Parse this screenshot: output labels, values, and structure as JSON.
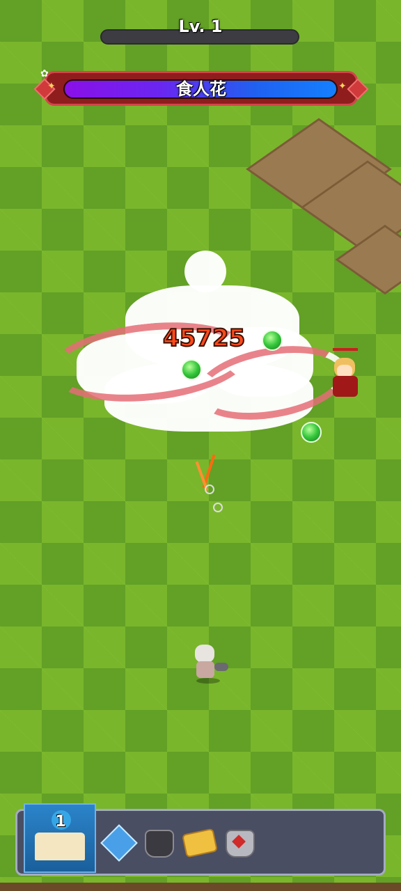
{
  "hud": {
    "level_label": "Lv. 1"
  },
  "boss": {
    "name": "食人花",
    "hp_fraction": 1.0
  },
  "combat": {
    "damage_numbers": [
      "4",
      "5",
      "7",
      "2",
      "5"
    ],
    "damage_display": "45725"
  },
  "skill_bar": {
    "book_level": "1",
    "slots": [
      {
        "icon": "ice-crystal-icon"
      },
      {
        "icon": "dark-armor-icon"
      },
      {
        "icon": "scroll-icon"
      },
      {
        "icon": "heart-armor-icon"
      }
    ]
  },
  "colors": {
    "grass_dark": "#62a026",
    "grass_light": "#8cc832",
    "boss_frame": "#8f1d1d",
    "hp_purple": "#8a10e8",
    "hp_blue": "#1480ff",
    "skill_panel": "#4a4e63"
  }
}
